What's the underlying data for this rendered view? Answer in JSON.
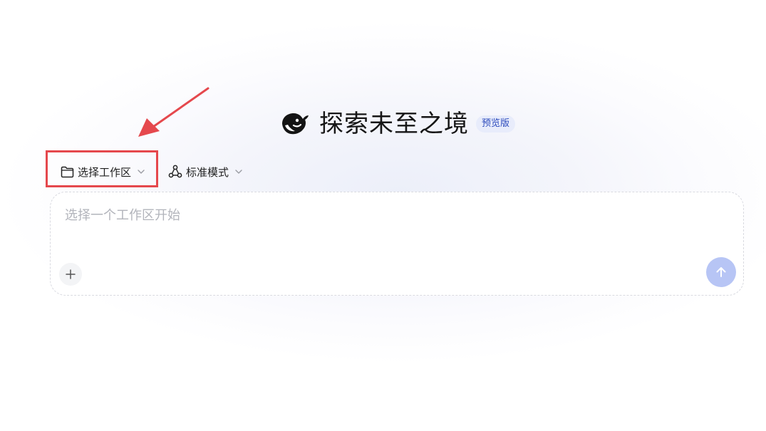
{
  "header": {
    "title": "探索未至之境",
    "badge": "预览版",
    "logo_icon": "whale-logo-icon"
  },
  "toolbar": {
    "workspace": {
      "label": "选择工作区",
      "icon": "folder-icon"
    },
    "mode": {
      "label": "标准模式",
      "icon": "mode-nodes-icon"
    }
  },
  "composer": {
    "placeholder": "选择一个工作区开始",
    "value": "",
    "add_icon": "plus-icon",
    "send_icon": "arrow-up-icon"
  },
  "annotation": {
    "highlight_color": "#e5484d"
  },
  "colors": {
    "accent": "#2d4bbd",
    "send_disabled": "#b7c5f5",
    "badge_bg": "#e8ecfb"
  }
}
